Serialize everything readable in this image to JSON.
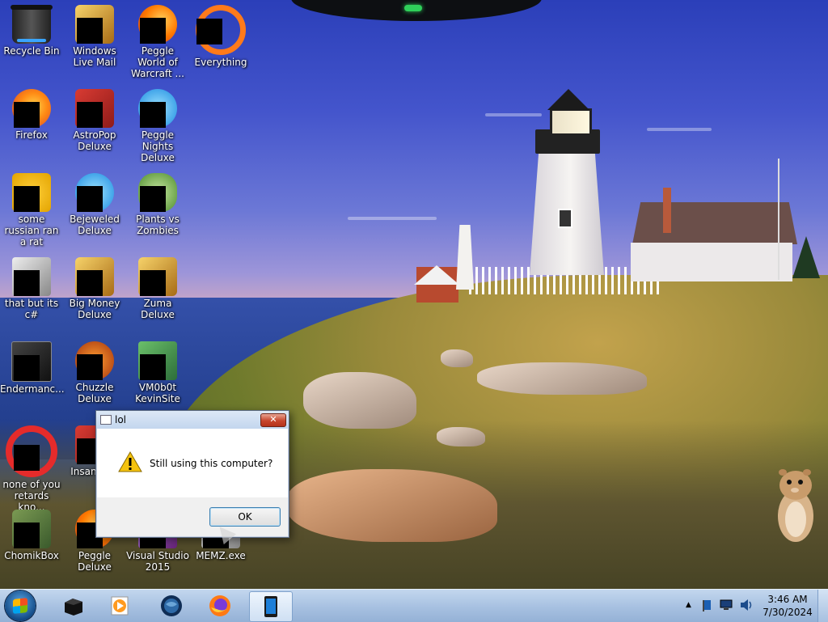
{
  "desktop": {
    "icons": [
      {
        "label": "Recycle Bin",
        "icon": "recycle-bin-icon"
      },
      {
        "label": "Windows Live Mail",
        "icon": "windows-live-mail-icon"
      },
      {
        "label": "Peggle World of Warcraft ...",
        "icon": "peggle-wow-icon"
      },
      {
        "label": "Everything",
        "icon": "everything-search-icon"
      },
      {
        "label": "Firefox",
        "icon": "firefox-icon"
      },
      {
        "label": "AstroPop Deluxe",
        "icon": "astropop-icon"
      },
      {
        "label": "Peggle Nights Deluxe",
        "icon": "peggle-nights-icon"
      },
      {
        "label": "some russian ran a rat",
        "icon": "script-file-icon"
      },
      {
        "label": "Bejeweled Deluxe",
        "icon": "bejeweled-icon"
      },
      {
        "label": "Plants vs Zombies",
        "icon": "plants-vs-zombies-icon"
      },
      {
        "label": "that but its c#",
        "icon": "copy-files-icon"
      },
      {
        "label": "Big Money Deluxe",
        "icon": "big-money-icon"
      },
      {
        "label": "Zuma Deluxe",
        "icon": "zuma-icon"
      },
      {
        "label": "Endermanc...",
        "icon": "console-app-icon"
      },
      {
        "label": "Chuzzle Deluxe",
        "icon": "chuzzle-icon"
      },
      {
        "label": "VM0b0t KevinSite",
        "icon": "vm-app-icon"
      },
      {
        "label": "none of you retards kno...",
        "icon": "opera-icon"
      },
      {
        "label": "Insani Del",
        "icon": "insaniquarium-icon"
      },
      {
        "label": "ChomikBox",
        "icon": "chomikbox-icon"
      },
      {
        "label": "Peggle Deluxe",
        "icon": "peggle-deluxe-icon"
      },
      {
        "label": "Visual Studio 2015",
        "icon": "visual-studio-icon"
      },
      {
        "label": "MEMZ.exe",
        "icon": "memz-exe-icon"
      }
    ]
  },
  "dialog": {
    "title": "lol",
    "message": "Still using this computer?",
    "ok_label": "OK",
    "close_symbol": "✕"
  },
  "taskbar": {
    "pinned": [
      {
        "name": "black-box-app",
        "icon": "black-cube-icon"
      },
      {
        "name": "media-player",
        "icon": "media-player-icon"
      },
      {
        "name": "globe-app",
        "icon": "globe-icon"
      },
      {
        "name": "firefox",
        "icon": "firefox-icon"
      },
      {
        "name": "tablet-app",
        "icon": "tablet-icon"
      }
    ],
    "clock": {
      "time": "3:46 AM",
      "date": "7/30/2024"
    }
  }
}
